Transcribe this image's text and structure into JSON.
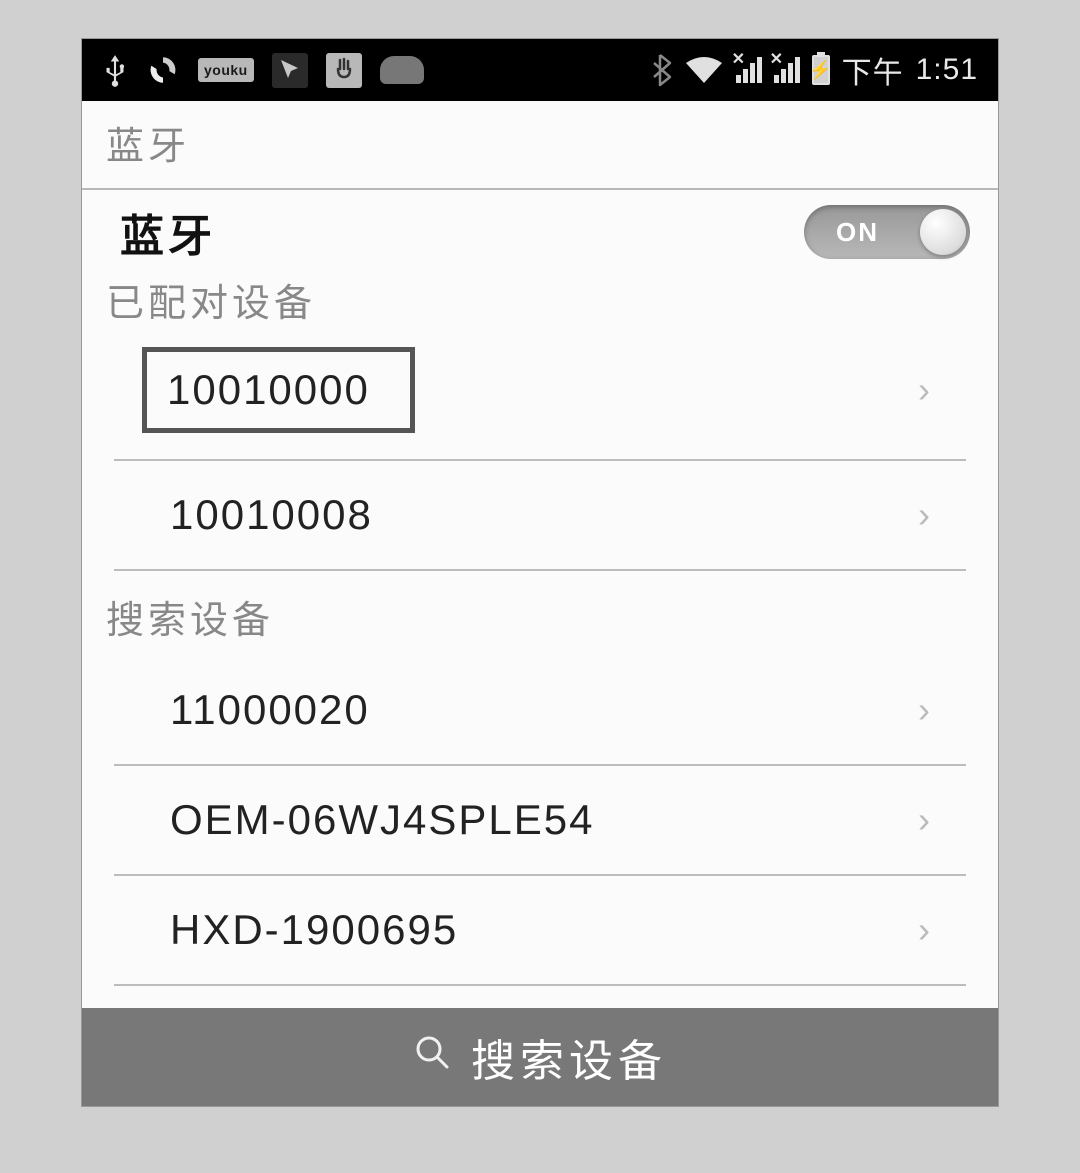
{
  "status_bar": {
    "icons_left": {
      "usb": "usb",
      "sync": "sync",
      "youku_label": "youku",
      "youku_sub": "优酷",
      "app1": "app",
      "app2": "hand",
      "android": "android"
    },
    "icons_right": {
      "bluetooth": "bluetooth",
      "wifi": "wifi",
      "signal1": "no-signal",
      "signal2": "no-signal",
      "battery": "charging"
    },
    "time_period": "下午",
    "time": "1:51"
  },
  "page": {
    "title": "蓝牙"
  },
  "toggle": {
    "label": "蓝牙",
    "state": "ON"
  },
  "sections": {
    "paired": {
      "header": "已配对设备",
      "items": [
        {
          "name": "10010000",
          "highlighted": true
        },
        {
          "name": "10010008",
          "highlighted": false
        }
      ]
    },
    "search": {
      "header": "搜索设备",
      "items": [
        {
          "name": "11000020"
        },
        {
          "name": "OEM-06WJ4SPLE54"
        },
        {
          "name": "HXD-1900695"
        }
      ]
    }
  },
  "bottom_button": {
    "label": "搜索设备"
  }
}
